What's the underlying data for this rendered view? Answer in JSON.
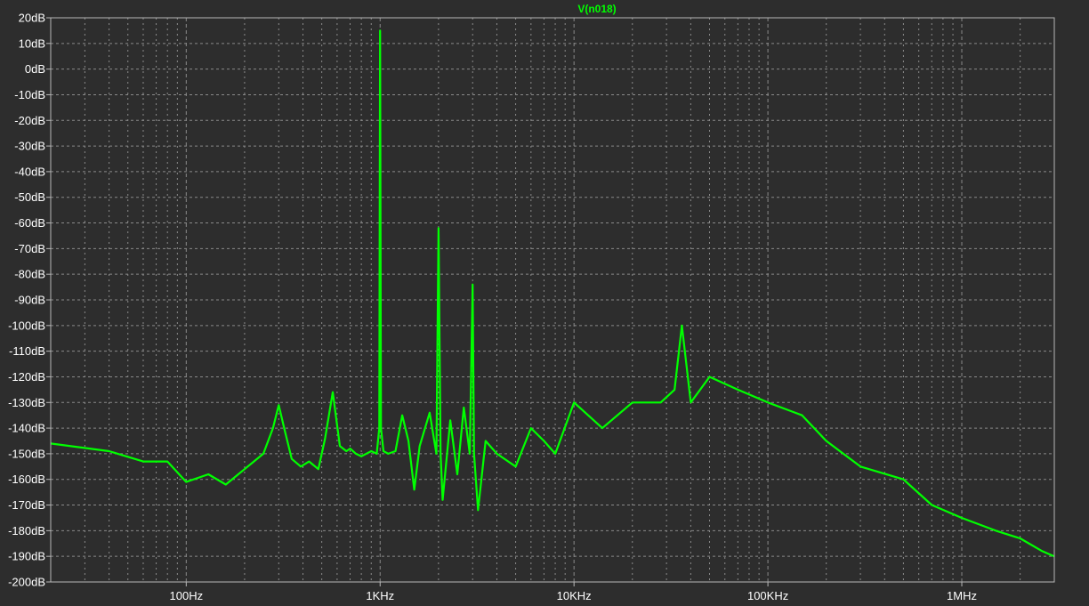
{
  "colors": {
    "background": "#2d2d2d",
    "plot_border": "#b8b8b8",
    "grid": "#8a8a8a",
    "trace": "#00ff00",
    "text": "#ffffff"
  },
  "chart_data": {
    "type": "line",
    "title": "V(n018)",
    "x_scale": "log",
    "xlim": [
      20,
      3000000
    ],
    "ylim": [
      -200,
      20
    ],
    "grid": true,
    "x_ticks": [
      {
        "value": 100,
        "label": "100Hz"
      },
      {
        "value": 1000,
        "label": "1KHz"
      },
      {
        "value": 10000,
        "label": "10KHz"
      },
      {
        "value": 100000,
        "label": "100KHz"
      },
      {
        "value": 1000000,
        "label": "1MHz"
      }
    ],
    "y_ticks": [
      {
        "value": 20,
        "label": "20dB"
      },
      {
        "value": 10,
        "label": "10dB"
      },
      {
        "value": 0,
        "label": "0dB"
      },
      {
        "value": -10,
        "label": "-10dB"
      },
      {
        "value": -20,
        "label": "-20dB"
      },
      {
        "value": -30,
        "label": "-30dB"
      },
      {
        "value": -40,
        "label": "-40dB"
      },
      {
        "value": -50,
        "label": "-50dB"
      },
      {
        "value": -60,
        "label": "-60dB"
      },
      {
        "value": -70,
        "label": "-70dB"
      },
      {
        "value": -80,
        "label": "-80dB"
      },
      {
        "value": -90,
        "label": "-90dB"
      },
      {
        "value": -100,
        "label": "-100dB"
      },
      {
        "value": -110,
        "label": "-110dB"
      },
      {
        "value": -120,
        "label": "-120dB"
      },
      {
        "value": -130,
        "label": "-130dB"
      },
      {
        "value": -140,
        "label": "-140dB"
      },
      {
        "value": -150,
        "label": "-150dB"
      },
      {
        "value": -160,
        "label": "-160dB"
      },
      {
        "value": -170,
        "label": "-170dB"
      },
      {
        "value": -180,
        "label": "-180dB"
      },
      {
        "value": -190,
        "label": "-190dB"
      },
      {
        "value": -200,
        "label": "-200dB"
      }
    ],
    "series": [
      {
        "name": "V(n018)",
        "x": [
          20,
          40,
          60,
          80,
          100,
          130,
          160,
          200,
          250,
          280,
          300,
          320,
          350,
          390,
          430,
          480,
          520,
          570,
          620,
          670,
          700,
          750,
          800,
          900,
          960,
          990,
          1000,
          1010,
          1040,
          1100,
          1200,
          1300,
          1400,
          1500,
          1600,
          1800,
          1950,
          2000,
          2050,
          2100,
          2300,
          2500,
          2700,
          2900,
          3000,
          3050,
          3200,
          3500,
          4000,
          5000,
          6000,
          7000,
          8000,
          10000,
          14000,
          20000,
          28000,
          33000,
          36000,
          40000,
          50000,
          70000,
          100000,
          150000,
          200000,
          300000,
          500000,
          700000,
          1000000,
          1500000,
          2000000,
          2600000,
          3000000
        ],
        "y": [
          -146,
          -149,
          -153,
          -153,
          -161,
          -158,
          -162,
          -156,
          -150,
          -140,
          -131,
          -140,
          -152,
          -155,
          -153,
          -156,
          -144,
          -126,
          -147,
          -149,
          -148,
          -150,
          -151,
          -149,
          -150,
          -140,
          15,
          -140,
          -149,
          -150,
          -149,
          -135,
          -145,
          -164,
          -147,
          -134,
          -150,
          -62,
          -150,
          -168,
          -137,
          -158,
          -132,
          -150,
          -84,
          -150,
          -172,
          -145,
          -150,
          -155,
          -140,
          -145,
          -150,
          -130,
          -140,
          -130,
          -130,
          -125,
          -100,
          -130,
          -120,
          -125,
          -130,
          -135,
          -145,
          -155,
          -160,
          -170,
          -175,
          -180,
          -183,
          -188,
          -190
        ]
      }
    ]
  }
}
